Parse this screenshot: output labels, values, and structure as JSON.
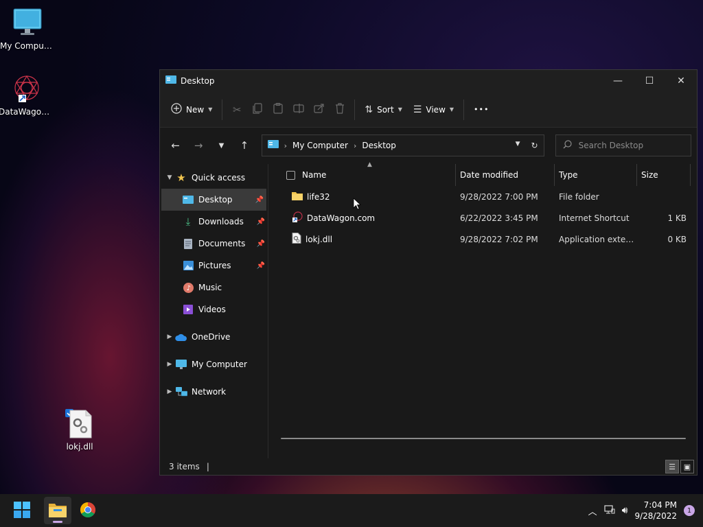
{
  "desktop": {
    "icons": [
      {
        "label": "My Computer"
      },
      {
        "label": "DataWagon..."
      },
      {
        "label": "lokj.dll"
      }
    ]
  },
  "window": {
    "title": "Desktop",
    "controls": {
      "minimize": "—",
      "maximize": "☐",
      "close": "✕"
    }
  },
  "toolbar": {
    "new_label": "New",
    "sort_label": "Sort",
    "view_label": "View",
    "more_label": "•••"
  },
  "address": {
    "crumbs": [
      "My Computer",
      "Desktop"
    ],
    "search_placeholder": "Search Desktop"
  },
  "sidebar": {
    "quick_access": "Quick access",
    "items": [
      {
        "label": "Desktop",
        "pinned": true
      },
      {
        "label": "Downloads",
        "pinned": true
      },
      {
        "label": "Documents",
        "pinned": true
      },
      {
        "label": "Pictures",
        "pinned": true
      },
      {
        "label": "Music"
      },
      {
        "label": "Videos"
      }
    ],
    "roots": [
      {
        "label": "OneDrive"
      },
      {
        "label": "My Computer"
      },
      {
        "label": "Network"
      }
    ]
  },
  "columns": {
    "name": "Name",
    "date": "Date modified",
    "type": "Type",
    "size": "Size"
  },
  "files": [
    {
      "name": "life32",
      "date": "9/28/2022 7:00 PM",
      "type": "File folder",
      "size": ""
    },
    {
      "name": "DataWagon.com",
      "date": "6/22/2022 3:45 PM",
      "type": "Internet Shortcut",
      "size": "1 KB"
    },
    {
      "name": "lokj.dll",
      "date": "9/28/2022 7:02 PM",
      "type": "Application exten...",
      "size": "0 KB"
    }
  ],
  "status": {
    "items": "3 items",
    "separator": "|"
  },
  "taskbar": {
    "time": "7:04 PM",
    "date": "9/28/2022",
    "notifications": "1"
  },
  "colors": {
    "accent": "#c9a6e6",
    "folder": "#f2c64f",
    "window_bg": "#191919"
  }
}
